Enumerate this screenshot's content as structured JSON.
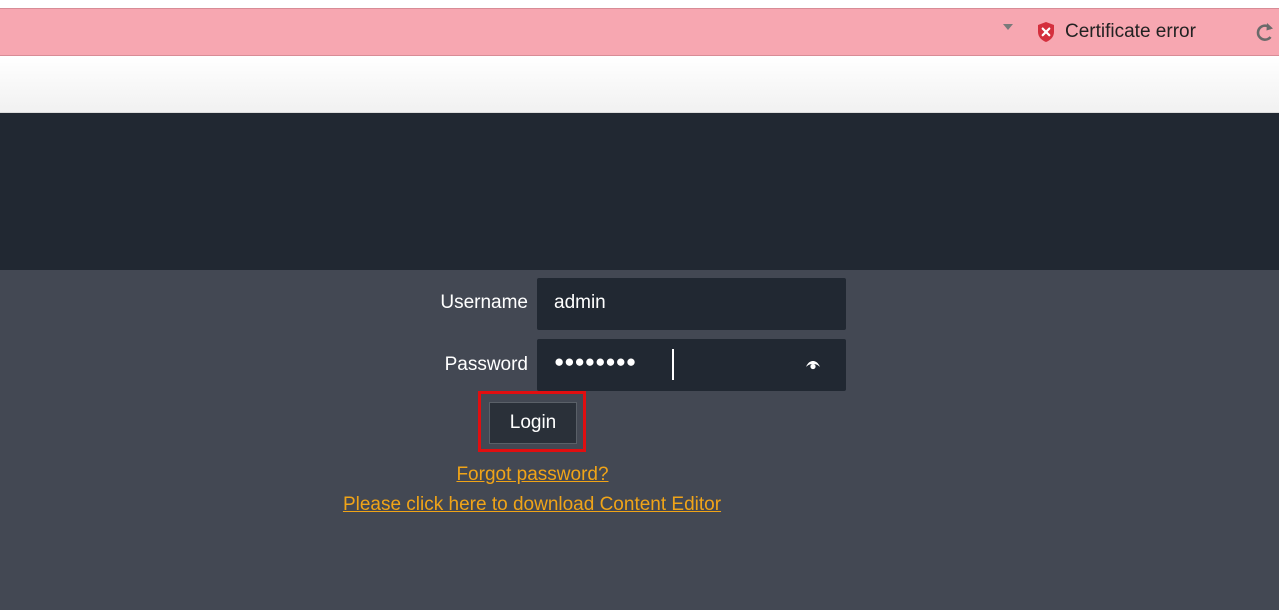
{
  "browser": {
    "certificate_error": "Certificate error",
    "icons": {
      "dropdown": "chevron-down-icon",
      "certificate": "shield-x-icon",
      "refresh": "refresh-icon"
    }
  },
  "login": {
    "username_label": "Username",
    "username_value": "admin",
    "password_label": "Password",
    "password_value": "●●●●●●●●",
    "login_button": "Login",
    "forgot_password": "Forgot password?",
    "download_link": "Please click here to download Content Editor"
  },
  "colors": {
    "address_bar_error": "#f7a7b1",
    "header": "#212832",
    "body": "#434853",
    "link": "#f0a418",
    "highlight": "#e10e10"
  }
}
